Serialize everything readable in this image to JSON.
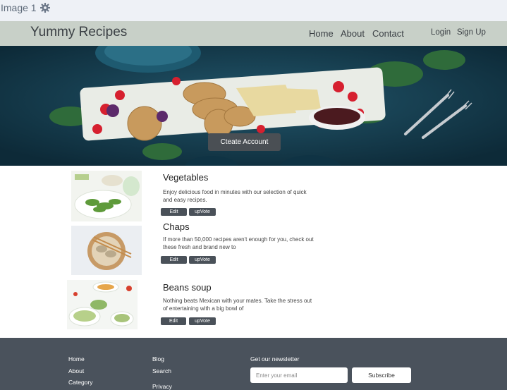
{
  "window": {
    "label": "Image 1",
    "settings_icon": "gear-icon"
  },
  "nav": {
    "brand": "Yummy Recipes",
    "links": [
      "Home",
      "About",
      "Contact"
    ],
    "login": "Login",
    "signup": "Sign Up"
  },
  "hero": {
    "cta_label": "Cteate Account"
  },
  "recipes": [
    {
      "title": "Vegetables",
      "description": "Enjoy delicious food in minutes with our selection of quick and easy recipes.",
      "edit_label": "Edit",
      "upvote_label": "upVote"
    },
    {
      "title": "Chaps",
      "description": "If more than 50,000 recipes aren't enough for you, check out these fresh and brand new to",
      "edit_label": "Edit",
      "upvote_label": "upVote"
    },
    {
      "title": "Beans soup",
      "description": "Nothing beats Mexican with your mates. Take the stress out of entertaining with a big bowl of",
      "edit_label": "Edit",
      "upvote_label": "upVote"
    }
  ],
  "footer": {
    "col1": [
      "Home",
      "About",
      "Category"
    ],
    "col2": [
      "Blog",
      "Search",
      "Privacy"
    ],
    "newsletter_label": "Get our newsletter",
    "email_placeholder": "Enter your email",
    "subscribe_label": "Subscribe"
  },
  "colors": {
    "navbar": "#c8d0c8",
    "footer": "#4a525c",
    "button_dark": "#4a5159",
    "hero_bg": "#14384a"
  }
}
